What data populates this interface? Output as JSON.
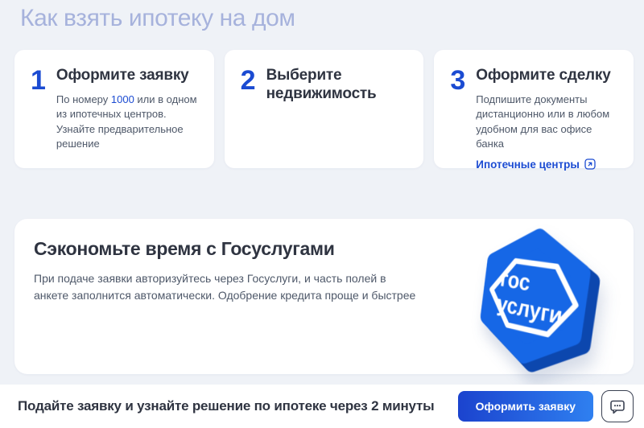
{
  "page_title": "Как взять ипотеку на дом",
  "steps": [
    {
      "number": "1",
      "title": "Оформите заявку",
      "desc_prefix": "По номеру ",
      "phone_link": "1000",
      "desc_suffix": " или в одном из ипотечных центров. Узнайте предварительное решение"
    },
    {
      "number": "2",
      "title": "Выберите недвижимость"
    },
    {
      "number": "3",
      "title": "Оформите сделку",
      "description": "Подпишите документы дистанционно или в любом удобном для вас офисе банка",
      "link_label": "Ипотечные центры"
    }
  ],
  "gosuslugi": {
    "title": "Сэкономьте время с Госуслугами",
    "description": "При подаче заявки авторизуйтесь через Госуслуги, и часть полей в анкете заполнится автоматически. Одобрение кредита проще и быстрее",
    "logo_line1": "гос",
    "logo_line2": "услуги"
  },
  "bottom_bar": {
    "text": "Подайте заявку и узнайте решение по ипотеке через 2 минуты",
    "cta_label": "Оформить заявку"
  },
  "icons": {
    "external_link": "external-link-icon",
    "chat": "chat-icon"
  },
  "colors": {
    "page_background": "#EFF2F7",
    "card_background": "#FFFFFF",
    "accent_blue": "#1B4BD2",
    "button_gradient_start": "#1B43CE",
    "button_gradient_end": "#2F80F0",
    "page_title_color": "#A6B2DC",
    "heading_color": "#2F3441",
    "body_text_color": "#4E5869",
    "gosuslugi_badge_face": "#1667E6",
    "gosuslugi_badge_side": "#0C47AE"
  }
}
